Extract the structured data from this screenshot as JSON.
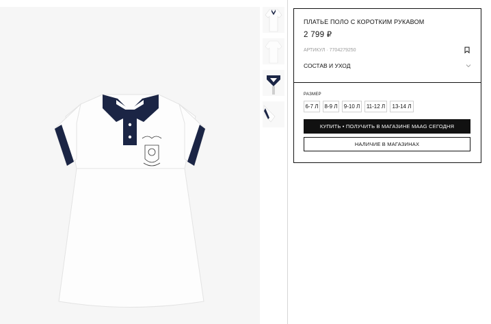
{
  "product": {
    "title": "ПЛАТЬЕ ПОЛО С КОРОТКИМ РУКАВОМ",
    "price": "2 799 ₽",
    "article_label": "АРТИКУЛ",
    "article_separator": "·",
    "article_number": "7704279250",
    "care_label": "СОСТАВ И УХОД"
  },
  "sizes": {
    "label": "РАЗМЕР",
    "options": [
      "6-7 Л",
      "8-9 Л",
      "9-10 Л",
      "11-12 Л",
      "13-14 Л"
    ]
  },
  "actions": {
    "buy_label": "КУПИТЬ • ПОЛУЧИТЬ В МАГАЗИНЕ MAAG СЕГОДНЯ",
    "stock_label": "НАЛИЧИЕ В МАГАЗИНАХ"
  },
  "gallery": {
    "thumbnail_count": 4,
    "product_colors": {
      "body": "#fdfdfd",
      "trim": "#1b2545"
    }
  },
  "colors": {
    "accent": "#111111",
    "muted": "#9a9a9a",
    "border": "#d0d0d0"
  },
  "icons": [
    "bookmark-icon",
    "chevron-down-icon"
  ]
}
